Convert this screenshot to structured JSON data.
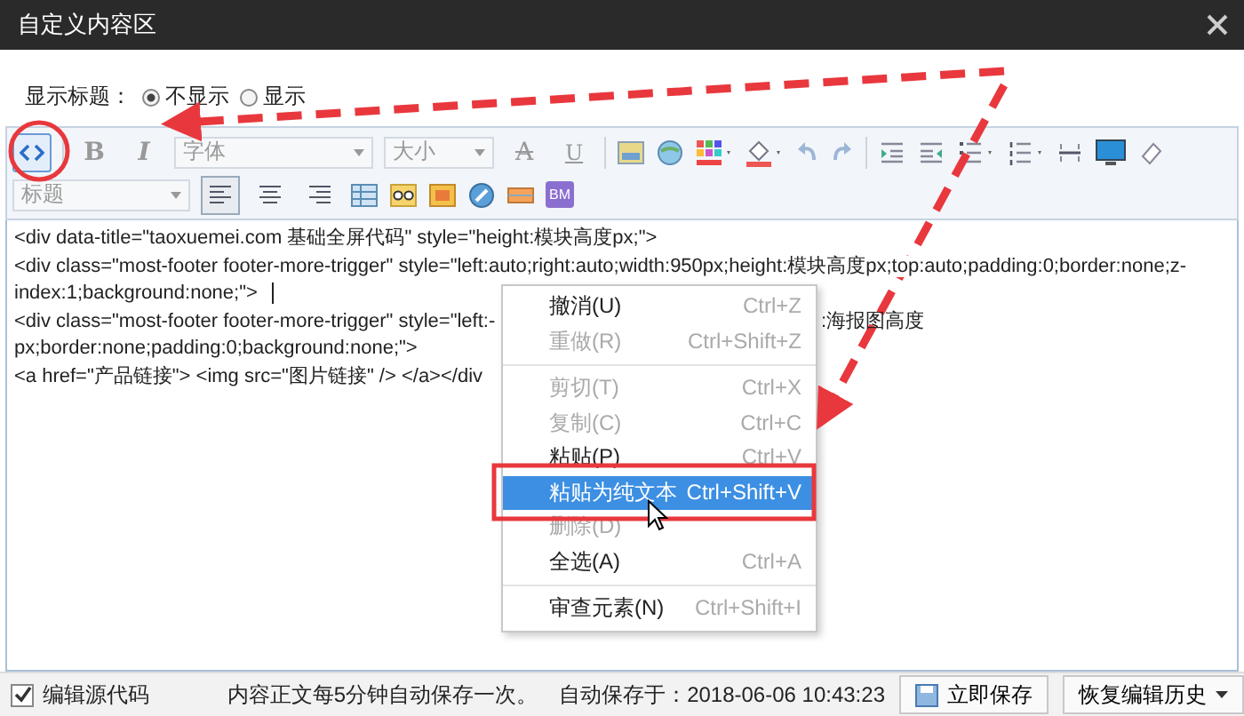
{
  "window": {
    "title": "自定义内容区"
  },
  "title_option": {
    "label": "显示标题：",
    "options": [
      {
        "label": "不显示",
        "selected": true
      },
      {
        "label": "显示",
        "selected": false
      }
    ]
  },
  "toolbar": {
    "source_selected": true,
    "bold": "B",
    "italic": "I",
    "font": "字体",
    "size": "大小",
    "strike": "A",
    "underline": "U",
    "heading": "标题",
    "align_left_selected": true,
    "bm": "BM"
  },
  "code_lines": [
    {
      "text": "<div data-title=\"taoxuemei.com 基础全屏代码\" style=\"height:模块高度px;\">"
    },
    {
      "text": "<div class=\"most-footer footer-more-trigger\" style=\"left:auto;right:auto;width:950px;height:模块高度px;top:auto;padding:0;border:none;z-"
    },
    {
      "text": "index:1;background:none;\">",
      "caret": true
    },
    {
      "text": "<div class=\"most-footer footer-more-trigger\" style=\"left:-",
      "after_menu": ":海报图高度"
    },
    {
      "text": "px;border:none;padding:0;background:none;\">"
    },
    {
      "text": "<a href=\"产品链接\"> <img src=\"图片链接\" /> </a></div"
    }
  ],
  "context_menu": [
    {
      "kind": "item",
      "label": "撤消(U)",
      "shortcut": "Ctrl+Z",
      "disabled": false,
      "selected": false
    },
    {
      "kind": "item",
      "label": "重做(R)",
      "shortcut": "Ctrl+Shift+Z",
      "disabled": true,
      "selected": false
    },
    {
      "kind": "separator"
    },
    {
      "kind": "item",
      "label": "剪切(T)",
      "shortcut": "Ctrl+X",
      "disabled": true,
      "selected": false
    },
    {
      "kind": "item",
      "label": "复制(C)",
      "shortcut": "Ctrl+C",
      "disabled": true,
      "selected": false
    },
    {
      "kind": "item",
      "label": "粘贴(P)",
      "shortcut": "Ctrl+V",
      "disabled": false,
      "selected": false
    },
    {
      "kind": "item",
      "label": "粘贴为纯文本",
      "shortcut": "Ctrl+Shift+V",
      "disabled": false,
      "selected": true
    },
    {
      "kind": "item",
      "label": "删除(D)",
      "disabled": true,
      "selected": false
    },
    {
      "kind": "item",
      "label": "全选(A)",
      "shortcut": "Ctrl+A",
      "disabled": false,
      "selected": false
    },
    {
      "kind": "separator"
    },
    {
      "kind": "item",
      "label": "审查元素(N)",
      "shortcut": "Ctrl+Shift+I",
      "disabled": false,
      "selected": false
    }
  ],
  "status_bar": {
    "source_checkbox": {
      "label": "编辑源代码",
      "checked": true
    },
    "autosave_note": "内容正文每5分钟自动保存一次。",
    "autosave_time": "自动保存于：2018-06-06 10:43:23",
    "save_button": "立即保存",
    "history_button": "恢复编辑历史"
  }
}
